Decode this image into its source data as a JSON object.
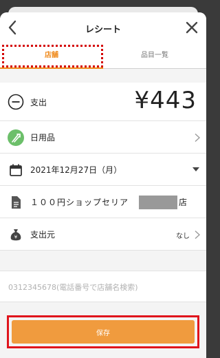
{
  "header": {
    "title": "レシート"
  },
  "tabs": [
    {
      "label": "店舗"
    },
    {
      "label": "品目一覧"
    }
  ],
  "transaction": {
    "type_label": "支出",
    "amount": "¥443",
    "category": "日用品",
    "date": "2021年12月27日（月）",
    "shop_name": "１００円ショップセリア",
    "shop_suffix": "店",
    "source_label": "支出元",
    "source_value": "なし"
  },
  "phone_search": {
    "placeholder": "0312345678(電話番号で店舗名検索)",
    "value": ""
  },
  "save_button": {
    "label": "保存"
  },
  "colors": {
    "accent": "#ef8a1c",
    "button": "#f09b3e",
    "category_icon": "#6cbf6a",
    "highlight": "#e0141c"
  },
  "icons": [
    "chevron-left-icon",
    "close-icon",
    "minus-circle-icon",
    "category-icon",
    "calendar-icon",
    "document-icon",
    "wallet-icon",
    "chevron-right-icon",
    "dropdown-arrow-icon"
  ]
}
